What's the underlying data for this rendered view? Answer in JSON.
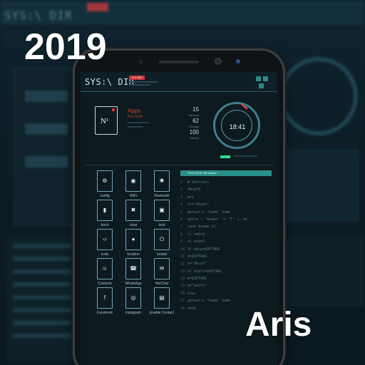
{
  "promo": {
    "year": "2019",
    "name": "Aris"
  },
  "background": {
    "title": "SYS:\\ DIR"
  },
  "header": {
    "title": "SYS:\\ DIR",
    "tag": "N 1 NO"
  },
  "card": {
    "glyph": "N¹",
    "apps_title": "Apps",
    "apps_sub": "PLUGIN"
  },
  "stats": [
    {
      "value": "15",
      "label": "Memory"
    },
    {
      "value": "62",
      "label": "Storage"
    },
    {
      "value": "100",
      "label": "Battery"
    }
  ],
  "clock": {
    "time": "18:41"
  },
  "tiles": [
    {
      "label": "config",
      "icon": "⚙",
      "icon_name": "gear-icon"
    },
    {
      "label": "WiFi",
      "icon": "◉",
      "icon_name": "wifi-icon"
    },
    {
      "label": "Bluetooth",
      "icon": "✱",
      "icon_name": "bluetooth-icon"
    },
    {
      "label": "torch",
      "icon": "▮",
      "icon_name": "torch-icon"
    },
    {
      "label": "clear",
      "icon": "✖",
      "icon_name": "trash-icon"
    },
    {
      "label": "lock",
      "icon": "▣",
      "icon_name": "lock-icon"
    },
    {
      "label": "code",
      "icon": "‹›",
      "icon_name": "code-icon"
    },
    {
      "label": "location",
      "icon": "●",
      "icon_name": "location-icon"
    },
    {
      "label": "restart",
      "icon": "⏻",
      "icon_name": "power-icon"
    },
    {
      "label": "Contacts",
      "icon": "☺",
      "icon_name": "contacts-icon"
    },
    {
      "label": "WhatsApp",
      "icon": "☎",
      "icon_name": "whatsapp-icon"
    },
    {
      "label": "WeChat",
      "icon": "✉",
      "icon_name": "wechat-icon"
    },
    {
      "label": "Facebook",
      "icon": "f",
      "icon_name": "facebook-icon"
    },
    {
      "label": "instagram",
      "icon": "◎",
      "icon_name": "instagram-icon"
    },
    {
      "label": "Enable Contact",
      "icon": "▤",
      "icon_name": "folder-icon"
    }
  ],
  "terminal": {
    "header": "SYS.CODE.NB-master",
    "lines": [
      "# define/n",
      "dbuy=0",
      "m=1",
      "ur=\"dbuyn\"",
      "getvar(s \"hedw\" home",
      "while ( \"$name\" != \"T\" ); do",
      "case $name in",
      "h) nm$=1",
      "a) wnb=1",
      "d) dbuy=$OPTARG",
      "m=$OPTARG",
      "w=\"dbuyn\"",
      "u) wnbfz=$OPTARG",
      "m=$OPTARG",
      "m=\"wnbfz\"",
      "esac",
      "getvar(s \"hedw\" home",
      "done"
    ]
  },
  "colors": {
    "accent": "#2a8e8a",
    "alert": "#d24444",
    "text": "#cfe7ee",
    "bg": "#0d1a1f"
  }
}
